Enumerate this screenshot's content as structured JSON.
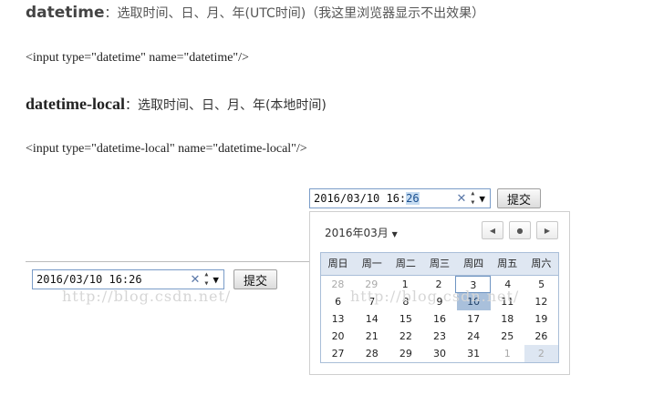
{
  "intro": {
    "datetime_keyword": "datetime",
    "datetime_desc": "：选取时间、日、月、年(UTC时间)（我这里浏览器显示不出效果）",
    "datetime_code": "<input type=\"datetime\" name=\"datetime\"/>",
    "local_keyword": "datetime-local",
    "local_desc": "：选取时间、日、月、年(本地时间)",
    "local_code": "<input type=\"datetime-local\" name=\"datetime-local\"/>"
  },
  "left_demo": {
    "value": "2016/03/10 16:26",
    "clear_icon": "✕",
    "drop_icon": "▼",
    "submit_label": "提交",
    "watermark": "http://blog.csdn.net/"
  },
  "right_demo": {
    "value_prefix": "2016/03/10 16:",
    "value_selected": "26",
    "clear_icon": "✕",
    "drop_icon": "▼",
    "submit_label": "提交",
    "watermark": "http://blog.csdn.net/"
  },
  "calendar": {
    "month_label": "2016年03月",
    "month_arrow": "▼",
    "nav_prev": "◀",
    "nav_today": "●",
    "nav_next": "▶",
    "weekdays": [
      "周日",
      "周一",
      "周二",
      "周三",
      "周四",
      "周五",
      "周六"
    ],
    "weeks": [
      [
        "28",
        "29",
        "1",
        "2",
        "3",
        "4",
        "5"
      ],
      [
        "6",
        "7",
        "8",
        "9",
        "10",
        "11",
        "12"
      ],
      [
        "13",
        "14",
        "15",
        "16",
        "17",
        "18",
        "19"
      ],
      [
        "20",
        "21",
        "22",
        "23",
        "24",
        "25",
        "26"
      ],
      [
        "27",
        "28",
        "29",
        "30",
        "31",
        "1",
        "2"
      ]
    ],
    "today": "3",
    "selected": "10"
  }
}
